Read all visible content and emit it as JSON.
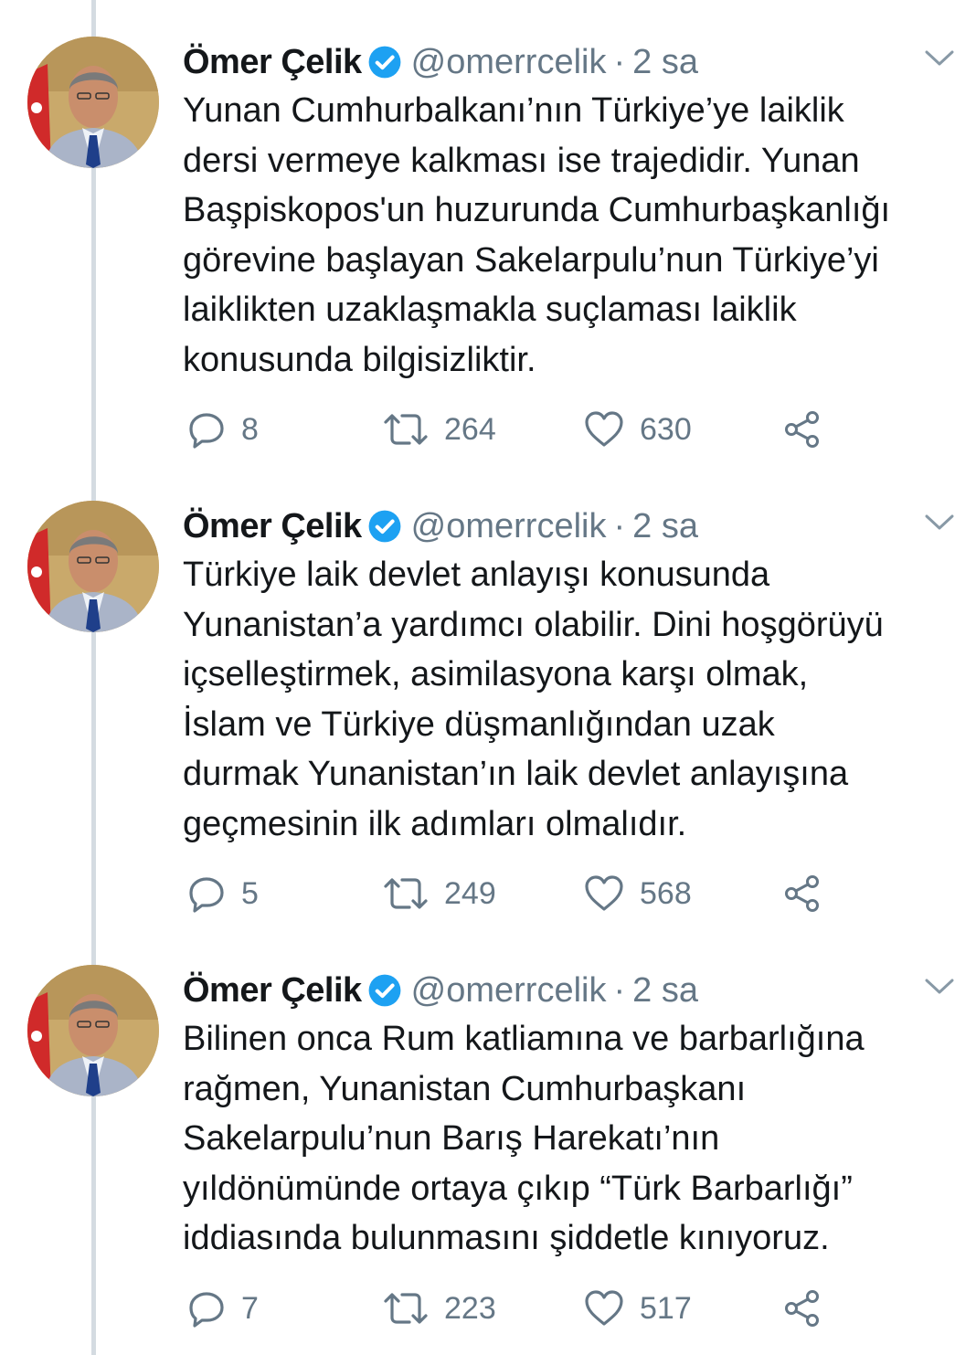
{
  "author": {
    "name": "Ömer Çelik",
    "handle": "@omerrcelik"
  },
  "colors": {
    "text": "#14171a",
    "secondary": "#657786",
    "verified": "#1da1f2",
    "thread_line": "#d4dbe1"
  },
  "icons": {
    "reply": "reply-icon",
    "retweet": "retweet-icon",
    "like": "heart-icon",
    "share": "share-icon",
    "more": "chevron-down-icon",
    "verified": "verified-badge-icon"
  },
  "tweets": [
    {
      "time": "2 sa",
      "lines": [
        "Yunan Cumhurbalkanı’nın Türkiye’ye laiklik",
        "dersi vermeye kalkması ise trajedidir. Yunan",
        "Başpiskopos'un huzurunda Cumhurbaşkanlığı",
        "görevine başlayan Sakelarpulu’nun Türkiye’yi",
        "laiklikten uzaklaşmakla suçlaması laiklik",
        "konusunda bilgisizliktir."
      ],
      "replies": "8",
      "retweets": "264",
      "likes": "630"
    },
    {
      "time": "2 sa",
      "lines": [
        "Türkiye laik devlet anlayışı konusunda",
        "Yunanistan’a yardımcı olabilir. Dini hoşgörüyü",
        "içselleştirmek, asimilasyona karşı olmak,",
        "İslam ve Türkiye düşmanlığından uzak",
        "durmak Yunanistan’ın laik devlet anlayışına",
        "geçmesinin ilk adımları olmalıdır."
      ],
      "replies": "5",
      "retweets": "249",
      "likes": "568"
    },
    {
      "time": "2 sa",
      "lines": [
        "Bilinen onca Rum katliamına ve barbarlığına",
        "rağmen, Yunanistan Cumhurbaşkanı",
        "Sakelarpulu’nun Barış Harekatı’nın",
        "yıldönümünde ortaya çıkıp “Türk Barbarlığı”",
        "iddiasında bulunmasını şiddetle kınıyoruz."
      ],
      "replies": "7",
      "retweets": "223",
      "likes": "517"
    }
  ]
}
